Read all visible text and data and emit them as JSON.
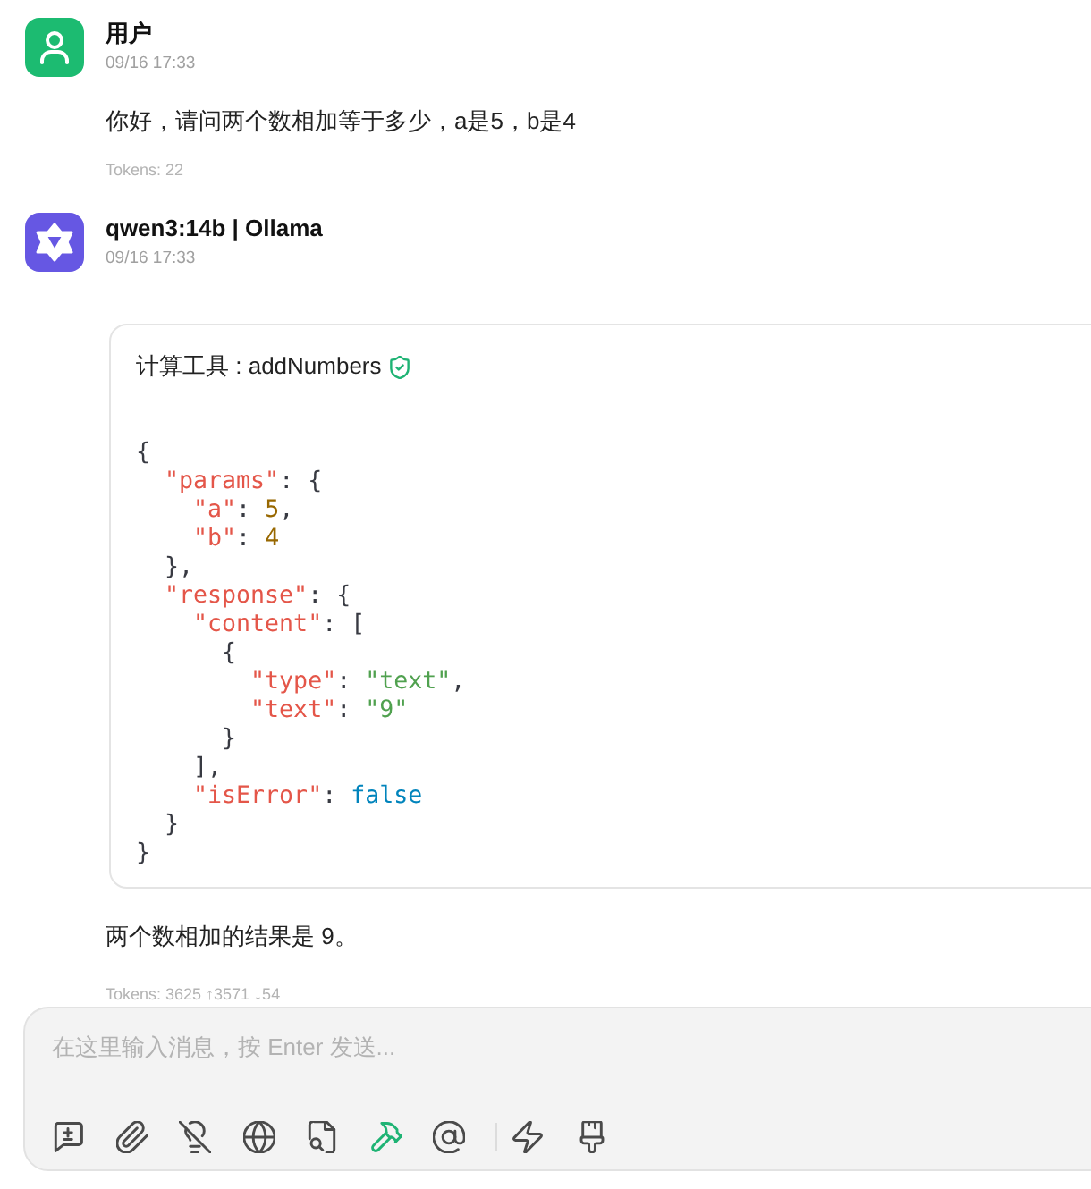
{
  "messages": [
    {
      "kind": "user",
      "author": "用户",
      "time": "09/16 17:33",
      "text": "你好，请问两个数相加等于多少，a是5，b是4",
      "tokens": "Tokens: 22"
    },
    {
      "kind": "assistant",
      "author": "qwen3:14b | Ollama",
      "time": "09/16 17:33",
      "tool_call": {
        "title": "计算工具 : addNumbers",
        "verified": true,
        "code_lines": [
          [
            {
              "text": "{",
              "kind": "punct"
            }
          ],
          [
            {
              "text": "  \"params\"",
              "kind": "key"
            },
            {
              "text": ": {",
              "kind": "punct"
            }
          ],
          [
            {
              "text": "    \"a\"",
              "kind": "key"
            },
            {
              "text": ": ",
              "kind": "punct"
            },
            {
              "text": "5",
              "kind": "number"
            },
            {
              "text": ",",
              "kind": "punct"
            }
          ],
          [
            {
              "text": "    \"b\"",
              "kind": "key"
            },
            {
              "text": ": ",
              "kind": "punct"
            },
            {
              "text": "4",
              "kind": "number"
            }
          ],
          [
            {
              "text": "  },",
              "kind": "punct"
            }
          ],
          [
            {
              "text": "  \"response\"",
              "kind": "key"
            },
            {
              "text": ": {",
              "kind": "punct"
            }
          ],
          [
            {
              "text": "    \"content\"",
              "kind": "key"
            },
            {
              "text": ": [",
              "kind": "punct"
            }
          ],
          [
            {
              "text": "      {",
              "kind": "punct"
            }
          ],
          [
            {
              "text": "        \"type\"",
              "kind": "key"
            },
            {
              "text": ": ",
              "kind": "punct"
            },
            {
              "text": "\"text\"",
              "kind": "string"
            },
            {
              "text": ",",
              "kind": "punct"
            }
          ],
          [
            {
              "text": "        \"text\"",
              "kind": "key"
            },
            {
              "text": ": ",
              "kind": "punct"
            },
            {
              "text": "\"9\"",
              "kind": "string"
            }
          ],
          [
            {
              "text": "      }",
              "kind": "punct"
            }
          ],
          [
            {
              "text": "    ],",
              "kind": "punct"
            }
          ],
          [
            {
              "text": "    \"isError\"",
              "kind": "key"
            },
            {
              "text": ": ",
              "kind": "punct"
            },
            {
              "text": "false",
              "kind": "boolean"
            }
          ],
          [
            {
              "text": "  }",
              "kind": "punct"
            }
          ],
          [
            {
              "text": "}",
              "kind": "punct"
            }
          ]
        ]
      },
      "text": "两个数相加的结果是 9。",
      "tokens": "Tokens: 3625 ↑3571 ↓54"
    }
  ],
  "composer": {
    "placeholder": "在这里输入消息，按 Enter 发送...",
    "tool_groups": [
      {
        "tools": [
          {
            "kind": "message-plus",
            "active": false
          },
          {
            "kind": "paperclip",
            "active": false
          },
          {
            "kind": "lightbulb-off",
            "active": false
          },
          {
            "kind": "globe",
            "active": false
          },
          {
            "kind": "file-search",
            "active": false
          },
          {
            "kind": "hammer",
            "active": true
          },
          {
            "kind": "at-sign",
            "active": false
          }
        ]
      },
      {
        "tools": [
          {
            "kind": "lightning",
            "active": false
          },
          {
            "kind": "brush",
            "active": false
          }
        ]
      }
    ]
  }
}
